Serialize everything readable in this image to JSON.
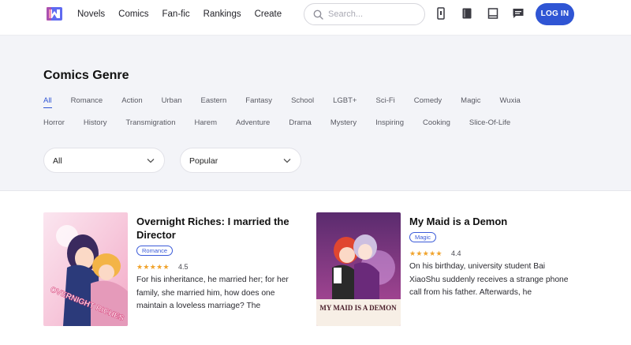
{
  "header": {
    "nav": [
      "Novels",
      "Comics",
      "Fan-fic",
      "Rankings",
      "Create"
    ],
    "search_placeholder": "Search...",
    "login_label": "LOG IN",
    "icons": [
      "logo-icon",
      "search-icon",
      "phone-icon",
      "book-icon",
      "library-icon",
      "chat-icon"
    ],
    "accent": "#2f55d4"
  },
  "genre": {
    "title": "Comics Genre",
    "row1": [
      "All",
      "Romance",
      "Action",
      "Urban",
      "Eastern",
      "Fantasy",
      "School",
      "LGBT+",
      "Sci-Fi",
      "Comedy",
      "Magic",
      "Wuxia"
    ],
    "row2": [
      "Horror",
      "History",
      "Transmigration",
      "Harem",
      "Adventure",
      "Drama",
      "Mystery",
      "Inspiring",
      "Cooking",
      "Slice-Of-Life"
    ],
    "active": "All",
    "filter_genre": "All",
    "filter_sort": "Popular"
  },
  "comics": [
    {
      "title": "Overnight Riches: I married the Director",
      "tag": "Romance",
      "stars": "★★★★★",
      "rating": "4.5",
      "description": "For his inheritance, he married her; for her family, she married him, how does one maintain a loveless marriage? The"
    },
    {
      "title": "My Maid is a Demon",
      "tag": "Magic",
      "stars": "★★★★★",
      "rating": "4.4",
      "description": "On his birthday, university student Bai XiaoShu suddenly receives a strange phone call from his father. Afterwards, he",
      "cover_text": "MY MAID IS A DEMON"
    }
  ]
}
